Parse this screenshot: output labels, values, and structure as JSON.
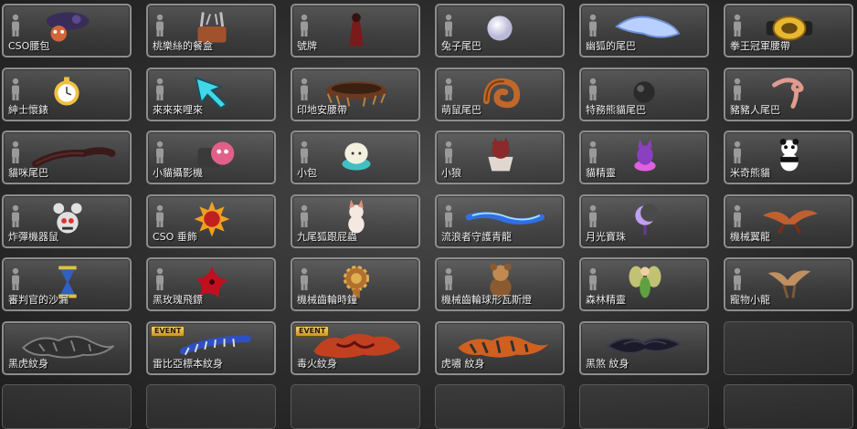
{
  "inventory": {
    "items": [
      {
        "label": "CSO腰包",
        "icon": "pouch-icon",
        "colors": [
          "#3a2c5a",
          "#d2663a"
        ]
      },
      {
        "label": "桃樂絲的餐盒",
        "icon": "basket-icon",
        "colors": [
          "#a0522d",
          "#c0c0c0"
        ]
      },
      {
        "label": "號牌",
        "icon": "robe-figure-icon",
        "colors": [
          "#7a1a1a",
          "#3a1010"
        ]
      },
      {
        "label": "兔子尾巴",
        "icon": "white-ball-icon",
        "colors": [
          "#f4f4ff",
          "#b8b8d8"
        ]
      },
      {
        "label": "幽狐的尾巴",
        "icon": "fox-tail-icon",
        "colors": [
          "#b8d0ff",
          "#6f8fd8"
        ]
      },
      {
        "label": "拳王冠軍腰帶",
        "icon": "championship-belt-icon",
        "colors": [
          "#e8b830",
          "#222222"
        ]
      },
      {
        "label": "紳士懷錶",
        "icon": "pocket-watch-icon",
        "colors": [
          "#f0c040",
          "#ffffff"
        ]
      },
      {
        "label": "來來來哩來",
        "icon": "arrow-cursor-icon",
        "colors": [
          "#40d8e8",
          "#1a5060"
        ]
      },
      {
        "label": "印地安腰帶",
        "icon": "native-belt-icon",
        "colors": [
          "#6b3a20",
          "#c08040"
        ]
      },
      {
        "label": "萌鼠尾巴",
        "icon": "spiral-tail-icon",
        "colors": [
          "#c0682a",
          "#7a3a10"
        ]
      },
      {
        "label": "特務熊貓尾巴",
        "icon": "dark-ball-icon",
        "colors": [
          "#2a2a2a",
          "#606060"
        ]
      },
      {
        "label": "豬豬人尾巴",
        "icon": "curly-tail-icon",
        "colors": [
          "#e09a90",
          "#b87068"
        ]
      },
      {
        "label": "貓咪尾巴",
        "icon": "cat-tail-icon",
        "colors": [
          "#3a1a1a",
          "#5a2a2a"
        ]
      },
      {
        "label": "小貓攝影機",
        "icon": "cat-camera-icon",
        "colors": [
          "#e0608a",
          "#3a3a3a"
        ]
      },
      {
        "label": "小包",
        "icon": "dumpling-icon",
        "colors": [
          "#f4f0e0",
          "#40c0c0"
        ]
      },
      {
        "label": "小狼",
        "icon": "wolf-cup-icon",
        "colors": [
          "#e0d8d0",
          "#8a2a2a"
        ]
      },
      {
        "label": "貓精靈",
        "icon": "cat-spirit-icon",
        "colors": [
          "#8a40c0",
          "#e060e0"
        ]
      },
      {
        "label": "米奇熊貓",
        "icon": "panda-icon",
        "colors": [
          "#ffffff",
          "#111111"
        ]
      },
      {
        "label": "炸彈機器鼠",
        "icon": "robot-mouse-icon",
        "colors": [
          "#e0e0e0",
          "#e03030"
        ]
      },
      {
        "label": "CSO 垂飾",
        "icon": "sun-medal-icon",
        "colors": [
          "#f0a020",
          "#c02020"
        ]
      },
      {
        "label": "九尾狐跟屁蟲",
        "icon": "fox-pet-icon",
        "colors": [
          "#f4e8e0",
          "#e09080"
        ]
      },
      {
        "label": "流浪者守護青龍",
        "icon": "blue-dragon-icon",
        "colors": [
          "#3070e0",
          "#a0e0ff"
        ]
      },
      {
        "label": "月光寶珠",
        "icon": "moon-orb-icon",
        "colors": [
          "#c0a0f0",
          "#6a3a9a"
        ]
      },
      {
        "label": "機械翼龍",
        "icon": "pterodactyl-icon",
        "colors": [
          "#c06030",
          "#7a3010"
        ]
      },
      {
        "label": "審判官的沙漏",
        "icon": "hourglass-icon",
        "colors": [
          "#3060c0",
          "#e0c040"
        ]
      },
      {
        "label": "黑玫瑰飛鏢",
        "icon": "shuriken-icon",
        "colors": [
          "#c01020",
          "#400008"
        ]
      },
      {
        "label": "機械齒輪時鐘",
        "icon": "gear-clock-icon",
        "colors": [
          "#b07030",
          "#e0b050"
        ]
      },
      {
        "label": "機械齒輪球形瓦斯燈",
        "icon": "gear-bear-icon",
        "colors": [
          "#8a5a30",
          "#c08a50"
        ]
      },
      {
        "label": "森林精靈",
        "icon": "fairy-icon",
        "colors": [
          "#e0e080",
          "#60a040"
        ]
      },
      {
        "label": "寵物小龍",
        "icon": "small-dragon-icon",
        "colors": [
          "#c09060",
          "#7a5a3a"
        ]
      },
      {
        "label": "黑虎紋身",
        "icon": "black-tiger-tattoo-icon",
        "colors": [
          "#303030",
          "#808080"
        ],
        "tattoo": true
      },
      {
        "label": "雷比亞標本紋身",
        "icon": "centipede-tattoo-icon",
        "colors": [
          "#3050c0",
          "#e0e0e0"
        ],
        "tattoo": true,
        "event": "EVENT"
      },
      {
        "label": "毒火紋身",
        "icon": "fire-beast-tattoo-icon",
        "colors": [
          "#c04020",
          "#601010"
        ],
        "tattoo": true,
        "event": "EVENT"
      },
      {
        "label": "虎嘯 紋身",
        "icon": "tiger-tattoo-icon",
        "colors": [
          "#d06020",
          "#303030"
        ],
        "tattoo": true
      },
      {
        "label": "黑煞 紋身",
        "icon": "tribal-tattoo-icon",
        "colors": [
          "#1a1a2a",
          "#3a3a4a"
        ],
        "tattoo": true
      }
    ],
    "empty_slots": 7
  }
}
